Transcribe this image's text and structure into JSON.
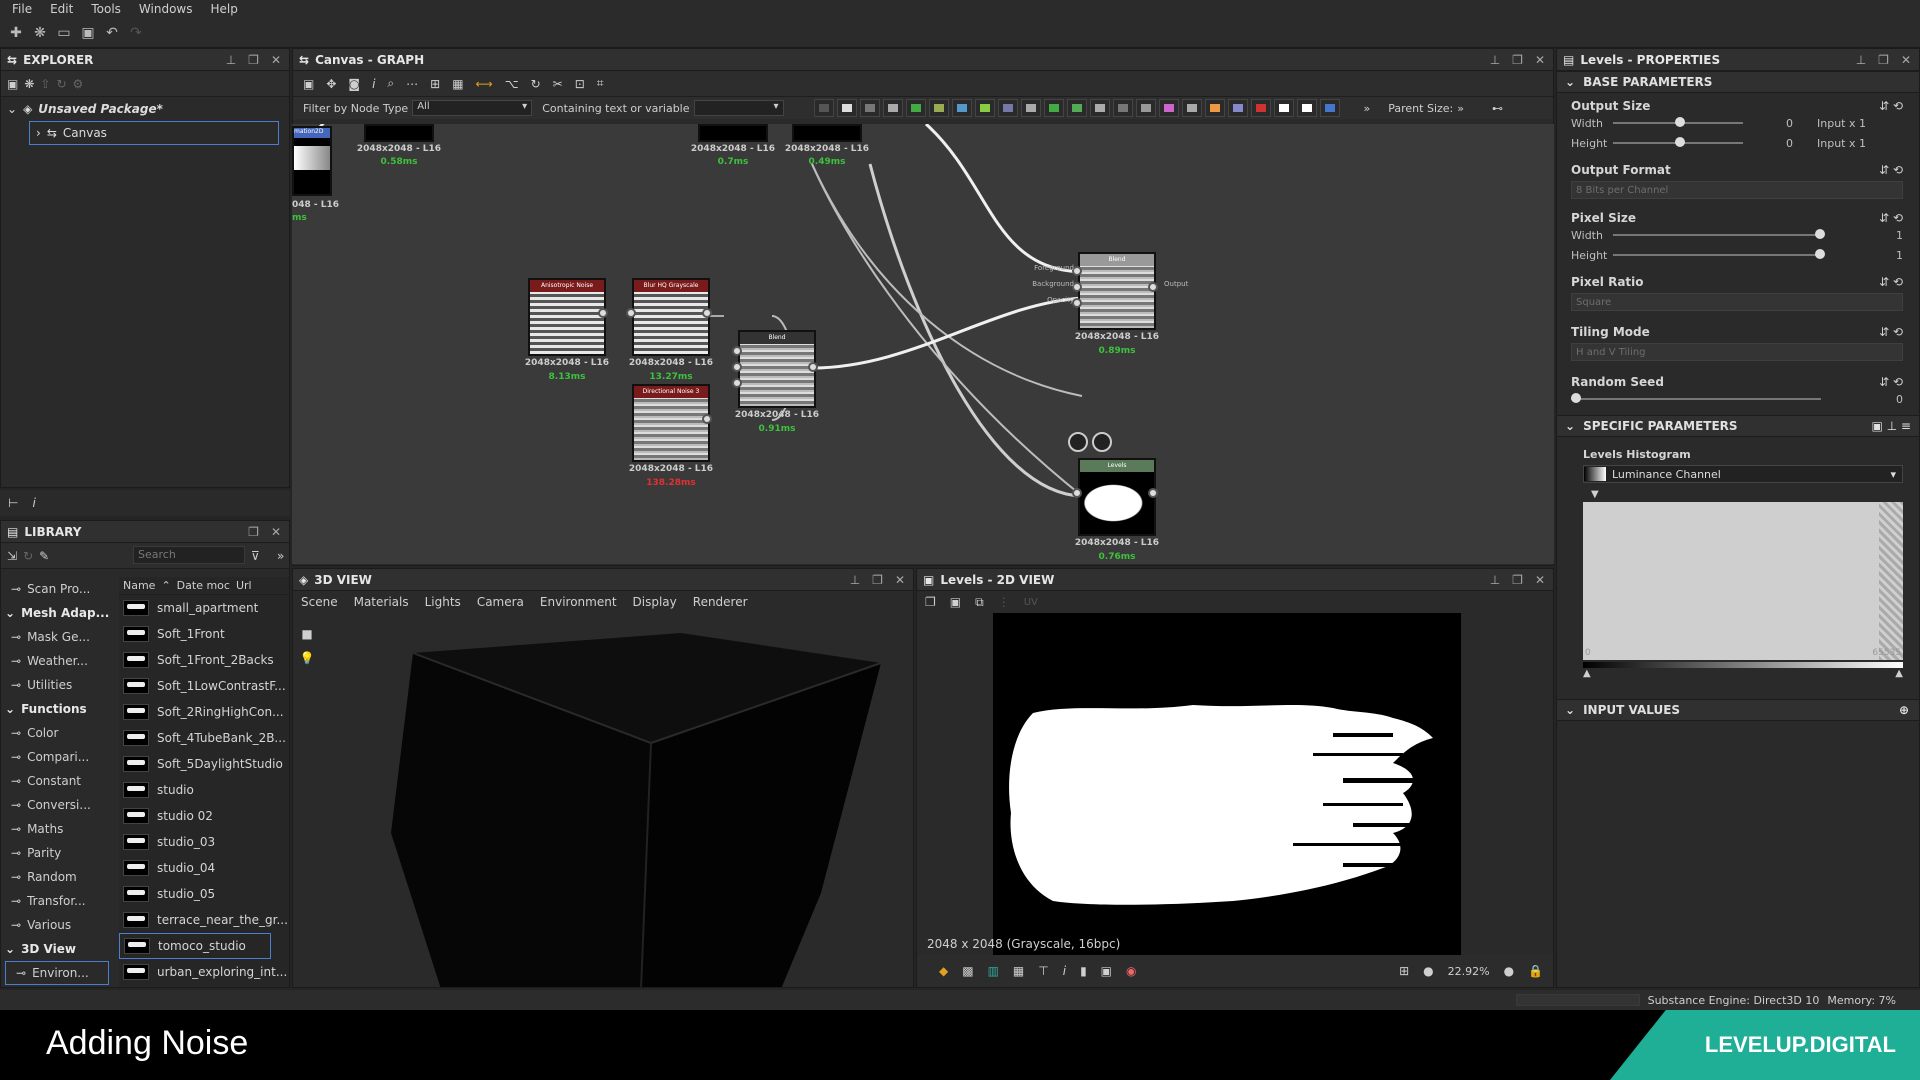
{
  "menu": [
    "File",
    "Edit",
    "Tools",
    "Windows",
    "Help"
  ],
  "explorer": {
    "title": "EXPLORER",
    "package": "Unsaved Package*",
    "canvas": "Canvas"
  },
  "library": {
    "title": "LIBRARY",
    "search_placeholder": "Search",
    "categories": [
      {
        "label": "Scan Pro...",
        "header": false
      },
      {
        "label": "Mesh Adap...",
        "header": true
      },
      {
        "label": "Mask Ge...",
        "header": false
      },
      {
        "label": "Weather...",
        "header": false
      },
      {
        "label": "Utilities",
        "header": false
      },
      {
        "label": "Functions",
        "header": true
      },
      {
        "label": "Color",
        "header": false
      },
      {
        "label": "Compari...",
        "header": false
      },
      {
        "label": "Constant",
        "header": false
      },
      {
        "label": "Conversi...",
        "header": false
      },
      {
        "label": "Maths",
        "header": false
      },
      {
        "label": "Parity",
        "header": false
      },
      {
        "label": "Random",
        "header": false
      },
      {
        "label": "Transfor...",
        "header": false
      },
      {
        "label": "Various",
        "header": false
      },
      {
        "label": "3D View",
        "header": true
      },
      {
        "label": "Environ...",
        "header": false
      }
    ],
    "columns": [
      "Name",
      "Date moc",
      "Url"
    ],
    "items": [
      "small_apartment",
      "Soft_1Front",
      "Soft_1Front_2Backs",
      "Soft_1LowContrastF...",
      "Soft_2RingHighCon...",
      "Soft_4TubeBank_2B...",
      "Soft_5DaylightStudio",
      "studio",
      "studio 02",
      "studio_03",
      "studio_04",
      "studio_05",
      "terrace_near_the_gr...",
      "tomoco_studio",
      "urban_exploring_int..."
    ],
    "selected": "tomoco_studio"
  },
  "graph": {
    "title": "Canvas - GRAPH",
    "filter_label": "Filter by Node Type",
    "filter_value": "All",
    "containing_label": "Containing text or variable",
    "parent_size_label": "Parent Size:",
    "top_nodes": [
      {
        "label": "2048x2048 - L16",
        "ms": "0.58ms"
      },
      {
        "label": "2048x2048 - L16",
        "ms": "0.7ms"
      },
      {
        "label": "2048x2048 - L16",
        "ms": "0.49ms"
      }
    ],
    "left_partial": {
      "title": "mation2D",
      "label": "048 - L16",
      "ms": "ms"
    },
    "nodes": [
      {
        "id": "aniso",
        "title": "Anisotropic Noise",
        "label": "2048x2048 - L16",
        "ms": "8.13ms",
        "ms_red": false
      },
      {
        "id": "blurhq",
        "title": "Blur HQ Grayscale",
        "label": "2048x2048 - L16",
        "ms": "13.27ms",
        "ms_red": false
      },
      {
        "id": "dirnoise",
        "title": "Directional Noise 3",
        "label": "2048x2048 - L16",
        "ms": "138.28ms",
        "ms_red": true
      },
      {
        "id": "blend1",
        "title": "Blend",
        "label": "2048x2048 - L16",
        "ms": "0.91ms",
        "ms_red": false
      },
      {
        "id": "blend2",
        "title": "Blend",
        "label": "2048x2048 - L16",
        "ms": "0.89ms",
        "ms_red": false
      },
      {
        "id": "levels",
        "title": "Levels",
        "label": "2048x2048 - L16",
        "ms": "0.76ms",
        "ms_red": false
      }
    ],
    "blend_ports": [
      "Foreground",
      "Background",
      "Opacity"
    ],
    "blend_output": "Output"
  },
  "view3d": {
    "title": "3D VIEW",
    "menu": [
      "Scene",
      "Materials",
      "Lights",
      "Camera",
      "Environment",
      "Display",
      "Renderer"
    ]
  },
  "view2d": {
    "title": "Levels - 2D VIEW",
    "uv_label": "UV",
    "info": "2048 x 2048 (Grayscale, 16bpc)",
    "zoom": "22.92%"
  },
  "properties": {
    "title": "Levels - PROPERTIES",
    "base_section": "BASE PARAMETERS",
    "output_size": {
      "label": "Output Size",
      "width_label": "Width",
      "height_label": "Height",
      "width_val": "0",
      "height_val": "0",
      "width_mode": "Input x 1",
      "height_mode": "Input x 1"
    },
    "output_format": {
      "label": "Output Format",
      "value": "8 Bits per Channel"
    },
    "pixel_size": {
      "label": "Pixel Size",
      "width_label": "Width",
      "height_label": "Height",
      "width_val": "1",
      "height_val": "1"
    },
    "pixel_ratio": {
      "label": "Pixel Ratio",
      "value": "Square"
    },
    "tiling_mode": {
      "label": "Tiling Mode",
      "value": "H and V Tiling"
    },
    "random_seed": {
      "label": "Random Seed",
      "value": "0"
    },
    "specific_section": "SPECIFIC PARAMETERS",
    "histogram_label": "Levels Histogram",
    "channel": "Luminance Channel",
    "hist_min": "0",
    "hist_max": "65535",
    "input_section": "INPUT VALUES"
  },
  "status": {
    "engine": "Substance Engine: Direct3D 10",
    "memory": "Memory: 7%"
  },
  "footer": {
    "title": "Adding Noise",
    "brand": "LEVELUP.DIGITAL"
  },
  "colors": {
    "node_header": "#7a1b1b",
    "ms_green": "#3dc23d",
    "ms_red": "#e23030",
    "brand_teal": "#1fae96"
  }
}
